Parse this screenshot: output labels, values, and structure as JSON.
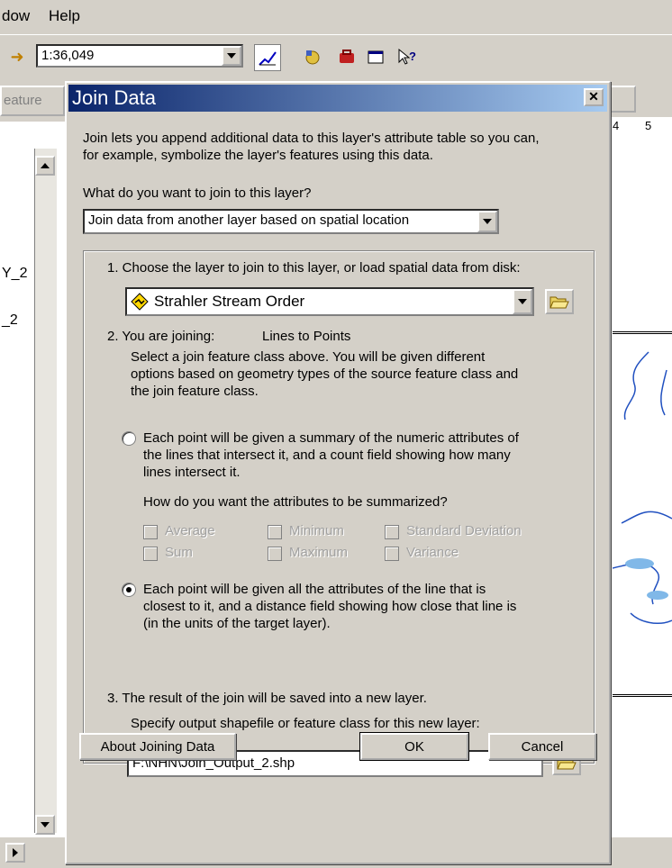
{
  "menubar": {
    "items": [
      "dow",
      "Help"
    ]
  },
  "toolbar": {
    "scale_value": "1:36,049"
  },
  "background": {
    "feature_tab_label": "eature",
    "toc_labels": [
      "Y_2",
      "_2"
    ],
    "ruler_numbers": [
      "4",
      "5"
    ]
  },
  "dialog": {
    "title": "Join Data",
    "close_label": "✕",
    "intro_line1": "Join lets you append additional data to this layer's attribute table so you can,",
    "intro_line2": "for example, symbolize the layer's features using this data.",
    "question": "What do you want to join to this layer?",
    "join_type": "Join data from another layer based on spatial location",
    "step1": "1.  Choose the layer to join to this layer, or load spatial data from disk:",
    "layer_name": "Strahler Stream Order",
    "step2_label": "2.  You are joining:",
    "step2_value": "Lines to Points",
    "step2_desc": [
      "Select a join feature class above.  You will be given different",
      "options based on geometry types of the source feature class and",
      "the join feature class."
    ],
    "option1_text": [
      "Each point will be given a summary of the numeric attributes of",
      "the lines that intersect it, and a count field showing how many",
      "lines intersect it."
    ],
    "summary_question": "How do you want the attributes to be summarized?",
    "summary_options": [
      "Average",
      "Minimum",
      "Standard Deviation",
      "Sum",
      "Maximum",
      "Variance"
    ],
    "option2_text": [
      "Each point will be given all the attributes of the line that is",
      "closest to it, and a distance field showing how close that line is",
      "(in the units of the target layer)."
    ],
    "selected_option": 2,
    "step3": "3.  The result of the join will be saved into a new layer.",
    "output_prompt": "Specify output shapefile or feature class for this new layer:",
    "output_path": "F:\\NHN\\Join_Output_2.shp",
    "about_button": "About Joining Data",
    "ok_button": "OK",
    "cancel_button": "Cancel"
  }
}
